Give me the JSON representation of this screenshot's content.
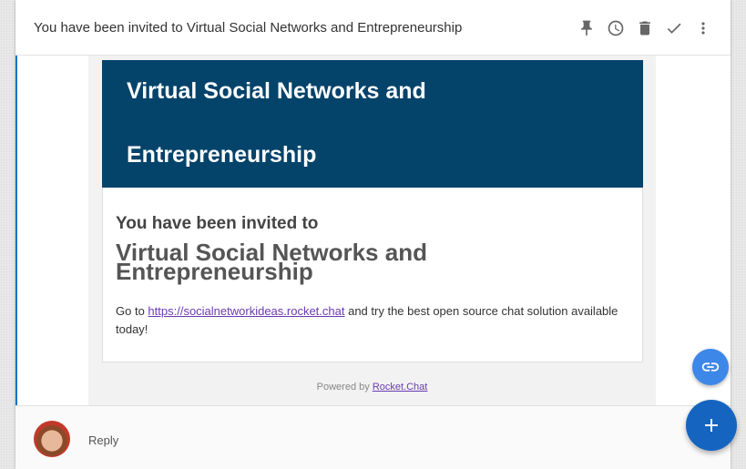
{
  "header": {
    "title": "You have been invited to Virtual Social Networks and Entrepreneurship",
    "toolbar": [
      {
        "name": "pin-icon"
      },
      {
        "name": "clock-icon"
      },
      {
        "name": "trash-icon"
      },
      {
        "name": "check-icon"
      },
      {
        "name": "more-vertical-icon"
      }
    ]
  },
  "email": {
    "banner_line1": "Virtual Social Networks and",
    "banner_line2": "Entrepreneurship",
    "invite_lead": "You have been invited to",
    "invite_name": "Virtual Social Networks and Entrepreneurship",
    "text_before_link": "Go to ",
    "link_text": "https://socialnetworkideas.rocket.chat",
    "text_after_link": " and try the best open source chat solution available today!",
    "powered_by": "Powered by ",
    "powered_link": "Rocket.Chat"
  },
  "footer": {
    "reply_placeholder": "Reply"
  },
  "colors": {
    "banner": "#04436a",
    "accent": "#1a73c8",
    "fab_link": "#3d87e8",
    "fab_add": "#1565c0",
    "link": "#6a3ab2"
  }
}
